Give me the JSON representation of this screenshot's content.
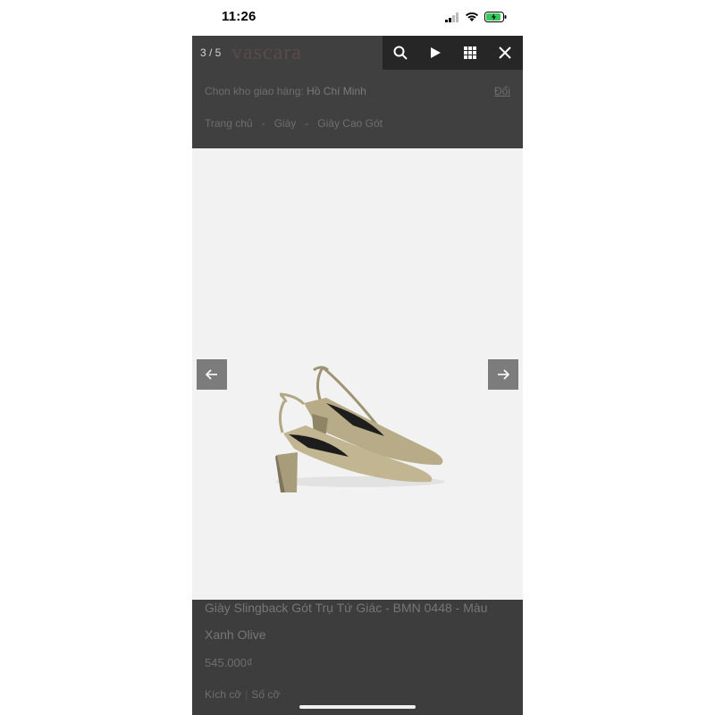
{
  "status": {
    "time": "11:26"
  },
  "viewer": {
    "counter": "3 / 5"
  },
  "header": {
    "logo": "vascara",
    "delivery_label": "Chọn kho giao hàng:",
    "delivery_city": "Hồ Chí Minh",
    "change_link": "Đổi"
  },
  "breadcrumb": {
    "items": [
      "Trang chủ",
      "-",
      "Giày",
      "-",
      "Giày Cao Gót"
    ]
  },
  "product": {
    "title": "Giày Slingback Gót Trụ Tứ Giác - BMN 0448 - Màu Xanh Olive",
    "price": "545.000₫",
    "size_label": "Kích cỡ",
    "size_value": "Số cỡ"
  },
  "toolbar": {
    "icons": [
      "search-icon",
      "play-icon",
      "grid-icon",
      "close-icon"
    ]
  },
  "colors": {
    "overlay": "#3a3a3a",
    "toolbar": "#262626",
    "image_bg": "#f2f2f2",
    "shoe": "#b9ad8a"
  }
}
